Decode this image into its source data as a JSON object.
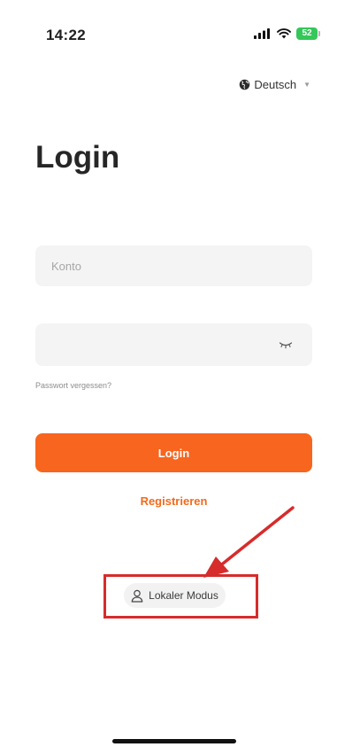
{
  "status_bar": {
    "time": "14:22",
    "battery": "52",
    "icons": [
      "signal-icon",
      "wifi-icon",
      "battery-icon"
    ]
  },
  "language": {
    "selected": "Deutsch",
    "icon": "globe-icon"
  },
  "login": {
    "title": "Login",
    "account_placeholder": "Konto",
    "account_value": "",
    "password_placeholder": "",
    "password_value": "",
    "password_toggle_icon": "eye-closed-icon",
    "forgot_password": "Passwort vergessen?",
    "login_button": "Login",
    "register": "Registrieren"
  },
  "local_mode": {
    "label": "Lokaler Modus",
    "icon": "user-icon"
  },
  "colors": {
    "accent": "#f7651f",
    "annotation": "#d62c2c",
    "battery": "#34c759"
  }
}
